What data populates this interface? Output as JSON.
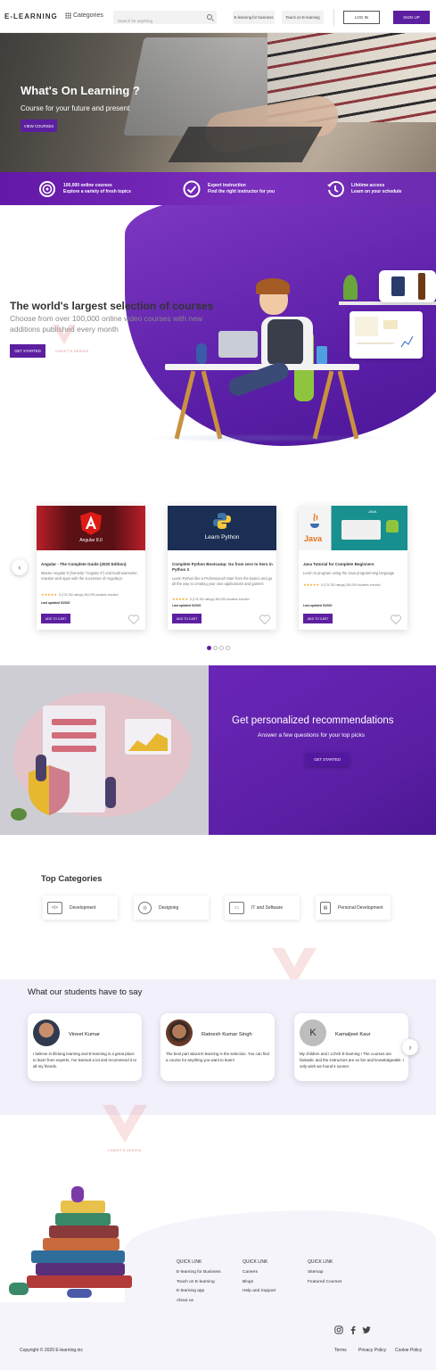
{
  "header": {
    "logo": "E-LEARNING",
    "categories_label": "Categories",
    "search_placeholder": "Search for anything",
    "business_label": "E-learning for business",
    "teach_label": "Teach on E-learning",
    "login_label": "LOG IN",
    "signup_label": "SIGN UP"
  },
  "hero": {
    "title": "What's On Learning ?",
    "subtitle": "Course for your future and present",
    "button": "VIEW COURSES"
  },
  "features": [
    {
      "line1": "100,000 online courses",
      "line2": "Explore a variety of fresh topics",
      "icon": "target-icon"
    },
    {
      "line1": "Expert instruction",
      "line2": "Find the right instructor for you",
      "icon": "check-circle-icon"
    },
    {
      "line1": "Lifetime access",
      "line2": "Learn on your schedule",
      "icon": "history-icon"
    }
  ],
  "world": {
    "title": "The world's largest selection of courses",
    "description": "Choose from over 100,000 online video courses with new additions published every month",
    "button": "GET STARTED",
    "watermark": "VINEET'S DESIGN"
  },
  "courses": [
    {
      "image_label": "Angular 8.0",
      "title": "Angular - The Complete Guide (2020 Edition)",
      "description": "Master Angular 9 (formerly \"Angular 2\") and build awesome, reactive web apps with the successor of Angular.js",
      "rating": "5 (178,782 ratings) 384,993 students enrolled",
      "updated": "Last updated 5/2020",
      "cart": "ADD TO CART"
    },
    {
      "image_label": "Learn Python",
      "title": "Complete Python Bootcamp: Go from zero to hero in Python 3",
      "description": "Learn Python like a Professional! Start from the basics and go all the way to creating your own applications and games!",
      "rating": "5 (178,782 ratings) 384,993 students enrolled",
      "updated": "Last updated 5/2020",
      "cart": "ADD TO CART"
    },
    {
      "image_label": "Java",
      "image_label2": "JAVA",
      "title": "Java Tutorial for Complete Beginners",
      "description": "Learn to program using the Java programming language",
      "rating": "5 (178,782 ratings) 384,993 students enrolled",
      "updated": "Last updated 5/2020",
      "cart": "ADD TO CART"
    }
  ],
  "carousel": {
    "prev": "‹",
    "next": "›",
    "active_dot": 0,
    "dot_count": 4
  },
  "reco": {
    "title": "Get personalized recommendations",
    "subtitle": "Answer a few questions for your top picks",
    "button": "GET STARTED"
  },
  "categories": {
    "title": "Top Categories",
    "items": [
      {
        "label": "Development",
        "icon": "code-icon",
        "glyph": "</>"
      },
      {
        "label": "Designing",
        "icon": "palette-icon",
        "glyph": "◎"
      },
      {
        "label": "IT and Software",
        "icon": "monitor-icon",
        "glyph": "▭"
      },
      {
        "label": "Personal Development",
        "icon": "notebook-icon",
        "glyph": "▤"
      }
    ]
  },
  "testimonials": {
    "title": "What our students have to say",
    "items": [
      {
        "name": "Vineet Kumar",
        "text": "I believe in lifelong learning and E-learning is a great place to learn from experts. I've learned a lot and recommend it to all my friends."
      },
      {
        "name": "Ratnesh Kumar Singh",
        "text": "The best part about E-learning is the selection. You can find a course for anything you want to learn!"
      },
      {
        "name": "Kamaljeet Kaur",
        "initial": "K",
        "text": "My children and I LOVE E-learning ! The courses are fantastic and the instructors are so fun and knowledgeable. I only wish we found it sooner."
      }
    ]
  },
  "footer": {
    "col1": {
      "heading": "QUICK LINK",
      "links": [
        "E-learning for Business",
        "Teach on E-learning",
        "E-learning app",
        "About us"
      ]
    },
    "col2": {
      "heading": "QUICK LINK",
      "links": [
        "Careers",
        "Blogs",
        "Help and Support"
      ]
    },
    "col3": {
      "heading": "QUICK LINK",
      "links": [
        "Sitemap",
        "Featured Courses"
      ]
    },
    "copyright": "Copyright © 2020 E-learning.inc",
    "terms": "Terms",
    "privacy": "Privacy Policy",
    "cookie": "Cookie Policy",
    "social": [
      "instagram-icon",
      "facebook-icon",
      "twitter-icon"
    ]
  },
  "colors": {
    "primary": "#5c1fa0",
    "accent_gradient_end": "#7a2fbd",
    "star": "#f1a526"
  }
}
